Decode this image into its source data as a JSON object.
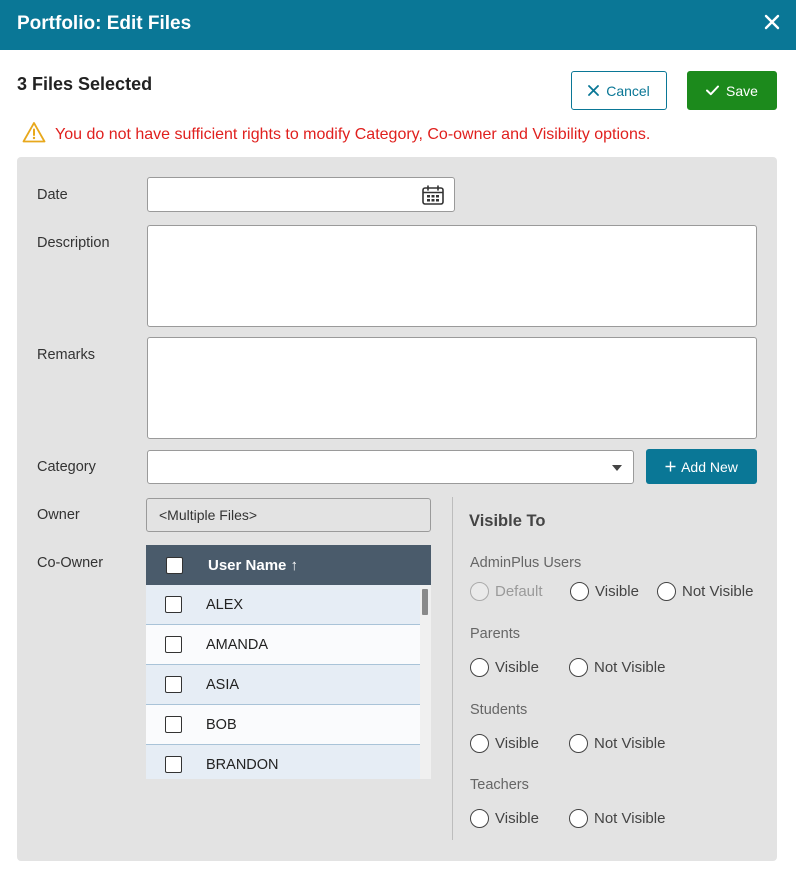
{
  "dialog": {
    "title": "Portfolio: Edit Files",
    "subtitle": "3 Files Selected",
    "cancel_label": "Cancel",
    "save_label": "Save",
    "warning": "You do not have sufficient rights to modify Category, Co-owner and Visibility options."
  },
  "form": {
    "date_label": "Date",
    "date_value": "",
    "description_label": "Description",
    "description_value": "",
    "remarks_label": "Remarks",
    "remarks_value": "",
    "category_label": "Category",
    "category_value": "",
    "add_new_label": "Add New",
    "owner_label": "Owner",
    "owner_value": "<Multiple Files>",
    "coowner_label": "Co-Owner"
  },
  "coowner_grid": {
    "column_header": "User Name ↑",
    "rows": [
      "ALEX",
      "AMANDA",
      "ASIA",
      "BOB",
      "BRANDON"
    ]
  },
  "visible_to": {
    "title": "Visible To",
    "groups": [
      {
        "name": "AdminPlus Users",
        "options": [
          "Default",
          "Visible",
          "Not Visible"
        ]
      },
      {
        "name": "Parents",
        "options": [
          "Visible",
          "Not Visible"
        ]
      },
      {
        "name": "Students",
        "options": [
          "Visible",
          "Not Visible"
        ]
      },
      {
        "name": "Teachers",
        "options": [
          "Visible",
          "Not Visible"
        ]
      }
    ]
  },
  "colors": {
    "header": "#0a7796",
    "save": "#1c8a1c",
    "warning": "#e0201e",
    "grid_header": "#4a5b6b"
  },
  "icons": [
    "close-icon",
    "x-icon",
    "check-icon",
    "warning-icon",
    "calendar-icon",
    "plus-icon",
    "caret-down-icon"
  ]
}
